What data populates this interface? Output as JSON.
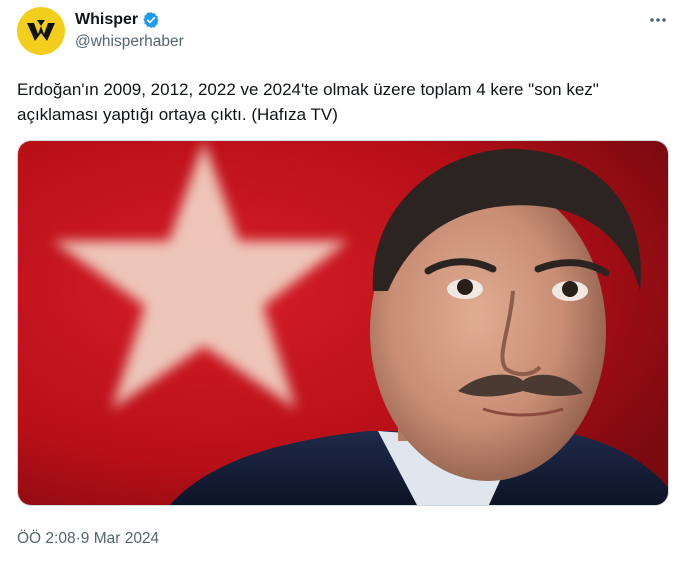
{
  "author": {
    "display_name": "Whisper",
    "handle": "@whisperhaber",
    "verified": true,
    "avatar_icon": "whisper-w-logo-icon",
    "avatar_color": "#f3ce1c"
  },
  "menu_icon": "more-dots-icon",
  "tweet": {
    "text": "Erdoğan'ın 2009, 2012, 2022 ve 2024'te olmak üzere toplam 4 kere \"son kez\" açıklaması yaptığı ortaya çıktı. (Hafıza TV)"
  },
  "media": {
    "description_icon": "portrait-photo-with-flag-background"
  },
  "meta": {
    "time": "ÖÖ 2:08",
    "separator": " · ",
    "date": "9 Mar 2024"
  },
  "colors": {
    "verified_blue": "#1d9bf0",
    "text_primary": "#0f1419",
    "text_secondary": "#536471",
    "flag_red": "#c8141e"
  }
}
